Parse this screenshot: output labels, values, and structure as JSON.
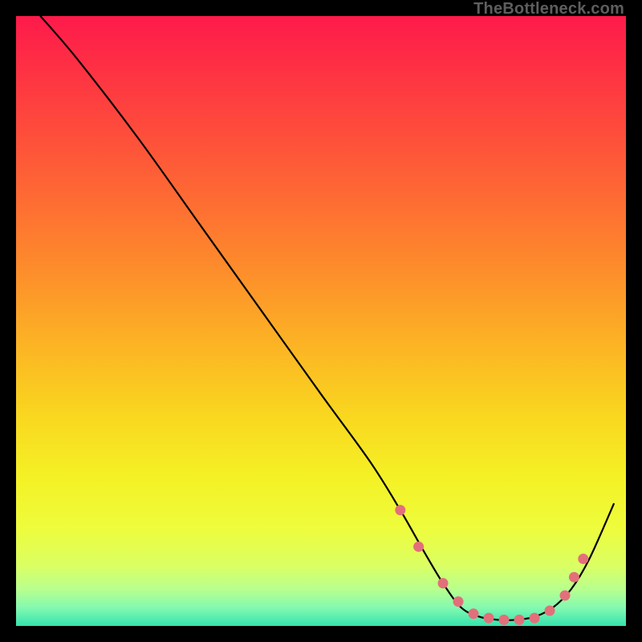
{
  "attribution": "TheBottleneck.com",
  "chart_data": {
    "type": "line",
    "title": "",
    "xlabel": "",
    "ylabel": "",
    "xlim": [
      0,
      100
    ],
    "ylim": [
      0,
      100
    ],
    "series": [
      {
        "name": "curve",
        "x": [
          4,
          10,
          20,
          30,
          40,
          50,
          58,
          63,
          67,
          70,
          73,
          76,
          79,
          82,
          85,
          88,
          91,
          94,
          98
        ],
        "y": [
          100,
          93,
          80,
          66,
          52,
          38,
          27,
          19,
          12,
          7,
          3,
          1.5,
          1,
          1,
          1.5,
          3,
          6,
          11,
          20
        ]
      }
    ],
    "markers": {
      "name": "dots",
      "color": "#e36f7a",
      "x": [
        63,
        66,
        70,
        72.5,
        75,
        77.5,
        80,
        82.5,
        85,
        87.5,
        90,
        91.5,
        93
      ],
      "y": [
        19,
        13,
        7,
        4,
        2,
        1.3,
        1,
        1,
        1.3,
        2.5,
        5,
        8,
        11
      ]
    },
    "gradient_stops": [
      {
        "offset": 0.0,
        "color": "#fe1a4b"
      },
      {
        "offset": 0.08,
        "color": "#fe2f44"
      },
      {
        "offset": 0.18,
        "color": "#fe4a3c"
      },
      {
        "offset": 0.3,
        "color": "#fe6b33"
      },
      {
        "offset": 0.42,
        "color": "#fd8e2b"
      },
      {
        "offset": 0.54,
        "color": "#fcb424"
      },
      {
        "offset": 0.66,
        "color": "#f9d81f"
      },
      {
        "offset": 0.76,
        "color": "#f4f226"
      },
      {
        "offset": 0.84,
        "color": "#eefc3c"
      },
      {
        "offset": 0.9,
        "color": "#dbff62"
      },
      {
        "offset": 0.94,
        "color": "#b8ff8e"
      },
      {
        "offset": 0.97,
        "color": "#84f9b0"
      },
      {
        "offset": 1.0,
        "color": "#34e3ae"
      }
    ]
  }
}
